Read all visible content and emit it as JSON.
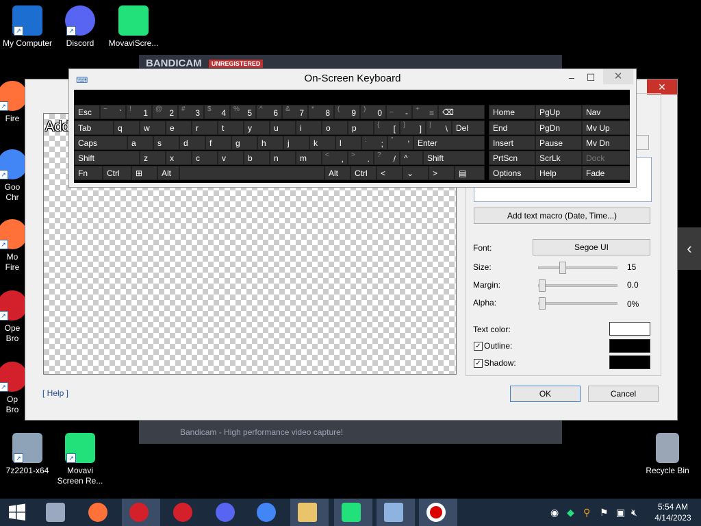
{
  "desktop": {
    "icons": [
      {
        "label": "My Computer"
      },
      {
        "label": "Discord"
      },
      {
        "label": "MovaviScre..."
      },
      {
        "label": "Fire"
      },
      {
        "label": "Goo"
      },
      {
        "label": "Chr"
      },
      {
        "label": "Mo"
      },
      {
        "label": "Fire"
      },
      {
        "label": "Ope"
      },
      {
        "label": "Bro"
      },
      {
        "label": "Op"
      },
      {
        "label": "Bro"
      },
      {
        "label": "7z2201-x64"
      },
      {
        "label": "Movavi"
      },
      {
        "label": "Screen Re..."
      },
      {
        "label": "Recycle Bin"
      }
    ],
    "colors": {
      "discord": "#5865f2",
      "movavi": "#22e07a",
      "opera": "#d4202a",
      "firefox": "#ff7139",
      "chrome": "#4285f4"
    }
  },
  "bandicam": {
    "title": "BANDICAM",
    "badge": "UNREGISTERED",
    "bottom_text": "Bandicam - High performance video capture!"
  },
  "dialog": {
    "preview_text": "Add",
    "help_link": "[ Help ]",
    "add_macro_button": "Add text macro (Date, Time...)",
    "font_label": "Font:",
    "font_value": "Segoe UI",
    "size_label": "Size:",
    "size_value": "15",
    "size_level": 0.28,
    "margin_label": "Margin:",
    "margin_value": "0.0",
    "margin_level": 0.0,
    "alpha_label": "Alpha:",
    "alpha_value": "0%",
    "alpha_level": 0.0,
    "text_color_label": "Text color:",
    "outline_label": "Outline:",
    "shadow_label": "Shadow:",
    "outline_checked": "✓",
    "shadow_checked": "✓",
    "text_color": "#ffffff",
    "outline_color": "#000000",
    "shadow_color": "#000000",
    "ok_button": "OK",
    "cancel_button": "Cancel",
    "close_glyph": "✕"
  },
  "osk": {
    "title": "On-Screen Keyboard",
    "minimize": "–",
    "maximize": "☐",
    "close": "✕",
    "keys": {
      "esc": "Esc",
      "tab": "Tab",
      "caps": "Caps",
      "shift": "Shift",
      "fn": "Fn",
      "ctrl": "Ctrl",
      "alt": "Alt",
      "del": "Del",
      "enter": "Enter",
      "home": "Home",
      "pgup": "PgUp",
      "nav": "Nav",
      "end": "End",
      "pgdn": "PgDn",
      "mvup": "Mv Up",
      "insert": "Insert",
      "pause": "Pause",
      "mvdn": "Mv Dn",
      "prtscn": "PrtScn",
      "scrlk": "ScrLk",
      "dock": "Dock",
      "options": "Options",
      "help": "Help",
      "fade": "Fade",
      "row1": [
        [
          "~",
          "`"
        ],
        [
          "!",
          "1"
        ],
        [
          "@",
          "2"
        ],
        [
          "#",
          "3"
        ],
        [
          "$",
          "4"
        ],
        [
          "%",
          "5"
        ],
        [
          "^",
          "6"
        ],
        [
          "&",
          "7"
        ],
        [
          "*",
          "8"
        ],
        [
          "(",
          "9"
        ],
        [
          ")",
          "0"
        ],
        [
          "_",
          "-"
        ],
        [
          "+",
          "="
        ]
      ],
      "row2": [
        "q",
        "w",
        "e",
        "r",
        "t",
        "y",
        "u",
        "i",
        "o",
        "p"
      ],
      "row2_br": [
        [
          "{",
          "["
        ],
        [
          "}",
          "]"
        ],
        [
          "|",
          "\\"
        ]
      ],
      "row3": [
        "a",
        "s",
        "d",
        "f",
        "g",
        "h",
        "j",
        "k",
        "l"
      ],
      "row3_p": [
        [
          ":",
          ";"
        ],
        [
          "\"",
          "'"
        ]
      ],
      "row4": [
        "z",
        "x",
        "c",
        "v",
        "b",
        "n",
        "m"
      ],
      "row4_p": [
        [
          "<",
          ","
        ],
        [
          ">",
          "."
        ],
        [
          "?",
          "/"
        ]
      ],
      "up": "^",
      "left": "<",
      "down": "⌄",
      "right": ">"
    }
  },
  "taskbar": {
    "time": "5:54 AM",
    "date": "4/14/2023"
  }
}
